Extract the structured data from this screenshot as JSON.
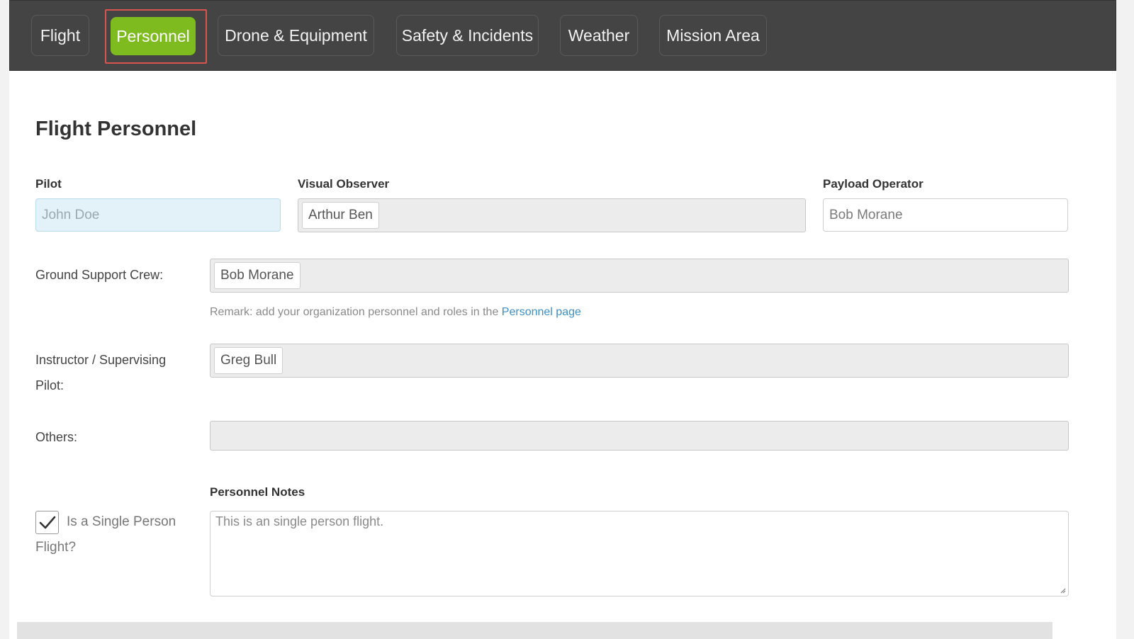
{
  "tabs": [
    {
      "label": "Flight"
    },
    {
      "label": "Personnel"
    },
    {
      "label": "Drone & Equipment"
    },
    {
      "label": "Safety & Incidents"
    },
    {
      "label": "Weather"
    },
    {
      "label": "Mission Area"
    }
  ],
  "active_tab": "Personnel",
  "section_title": "Flight Personnel",
  "pilot": {
    "label": "Pilot",
    "value": "John Doe"
  },
  "visual_observer": {
    "label": "Visual Observer",
    "tags": [
      "Arthur Ben"
    ]
  },
  "payload_operator": {
    "label": "Payload Operator",
    "value": "Bob Morane"
  },
  "ground_support": {
    "label": "Ground Support Crew:",
    "tags": [
      "Bob Morane"
    ]
  },
  "remark": {
    "text": "Remark: add your organization personnel and roles in the ",
    "link": "Personnel page"
  },
  "instructor": {
    "label": "Instructor / Supervising Pilot:",
    "tags": [
      "Greg Bull"
    ]
  },
  "others": {
    "label": "Others:"
  },
  "single_person": {
    "label": "Is a Single Person Flight?",
    "checked": true
  },
  "notes": {
    "label": "Personnel Notes",
    "value": "This is an single person flight."
  }
}
